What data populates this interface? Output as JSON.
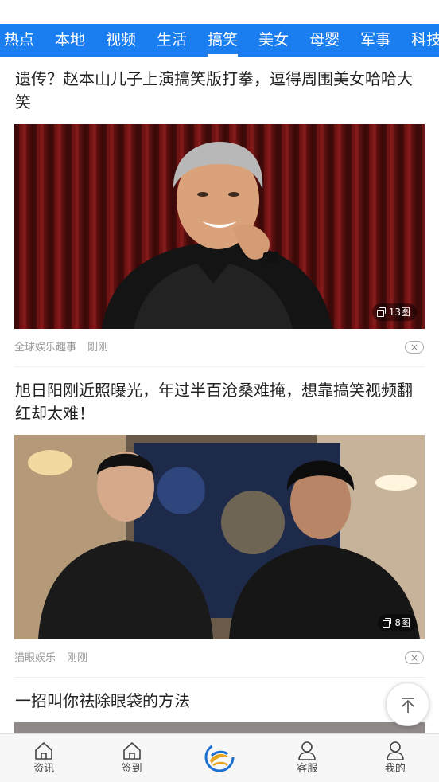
{
  "categories": [
    "热点",
    "本地",
    "视频",
    "生活",
    "搞笑",
    "美女",
    "母婴",
    "军事",
    "科技"
  ],
  "active_category": "搞笑",
  "articles": [
    {
      "title": "遗传？赵本山儿子上演搞笑版打拳，逗得周围美女哈哈大笑",
      "image_count": "13图",
      "source": "全球娱乐趣事",
      "time": "刚刚",
      "dismiss": "×"
    },
    {
      "title": "旭日阳刚近照曝光，年过半百沧桑难掩，想靠搞笑视频翻红却太难！",
      "image_count": "8图",
      "source": "猫眼娱乐",
      "time": "刚刚",
      "dismiss": "×"
    },
    {
      "title": "一招叫你祛除眼袋的方法"
    }
  ],
  "bottom_nav": [
    {
      "label": "资讯",
      "icon": "home-icon"
    },
    {
      "label": "签到",
      "icon": "home-icon"
    },
    {
      "label": "",
      "icon": "app-logo-icon"
    },
    {
      "label": "客服",
      "icon": "user-icon"
    },
    {
      "label": "我的",
      "icon": "user-icon"
    }
  ],
  "colors": {
    "accent": "#1a7df0",
    "logo_gold": "#e8a41a",
    "logo_blue": "#1a6fd1"
  }
}
